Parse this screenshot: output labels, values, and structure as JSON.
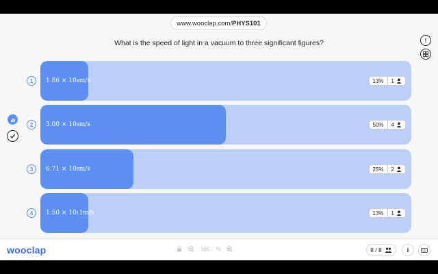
{
  "header": {
    "url_prefix": "www.wooclap.com/",
    "url_code": "PHYS101"
  },
  "question": "What is the speed of light in a vacuum to three significant figures?",
  "side_icons": {
    "top_right": "info-icon",
    "right_second": "grid-icon",
    "left_first": "chart-icon",
    "left_second": "check-icon"
  },
  "answers": [
    {
      "number": "1",
      "mantissa": "1.86",
      "times": "×",
      "base": "10",
      "exp": "4",
      "unit": "m/s",
      "percent_text": "13%",
      "percent": 13,
      "count": "1"
    },
    {
      "number": "2",
      "mantissa": "3.00",
      "times": "×",
      "base": "10",
      "exp": "8",
      "unit": "m/s",
      "percent_text": "50%",
      "percent": 50,
      "count": "4"
    },
    {
      "number": "3",
      "mantissa": "6.71",
      "times": "×",
      "base": "10",
      "exp": "8",
      "unit": "m/s",
      "percent_text": "25%",
      "percent": 25,
      "count": "2"
    },
    {
      "number": "4",
      "mantissa": "1.50",
      "times": "×",
      "base": "10",
      "exp": "1",
      "unit": "1m/s",
      "percent_text": "13%",
      "percent": 13,
      "count": "1"
    }
  ],
  "footer": {
    "logo": "wooclap",
    "zoom_level": "100",
    "zoom_unit": "%",
    "page": "8 / 8",
    "info_label": "i"
  },
  "colors": {
    "accent": "#5b8ff2",
    "bar_bg": "#bcd0f7",
    "logo": "#3b6fe0"
  }
}
